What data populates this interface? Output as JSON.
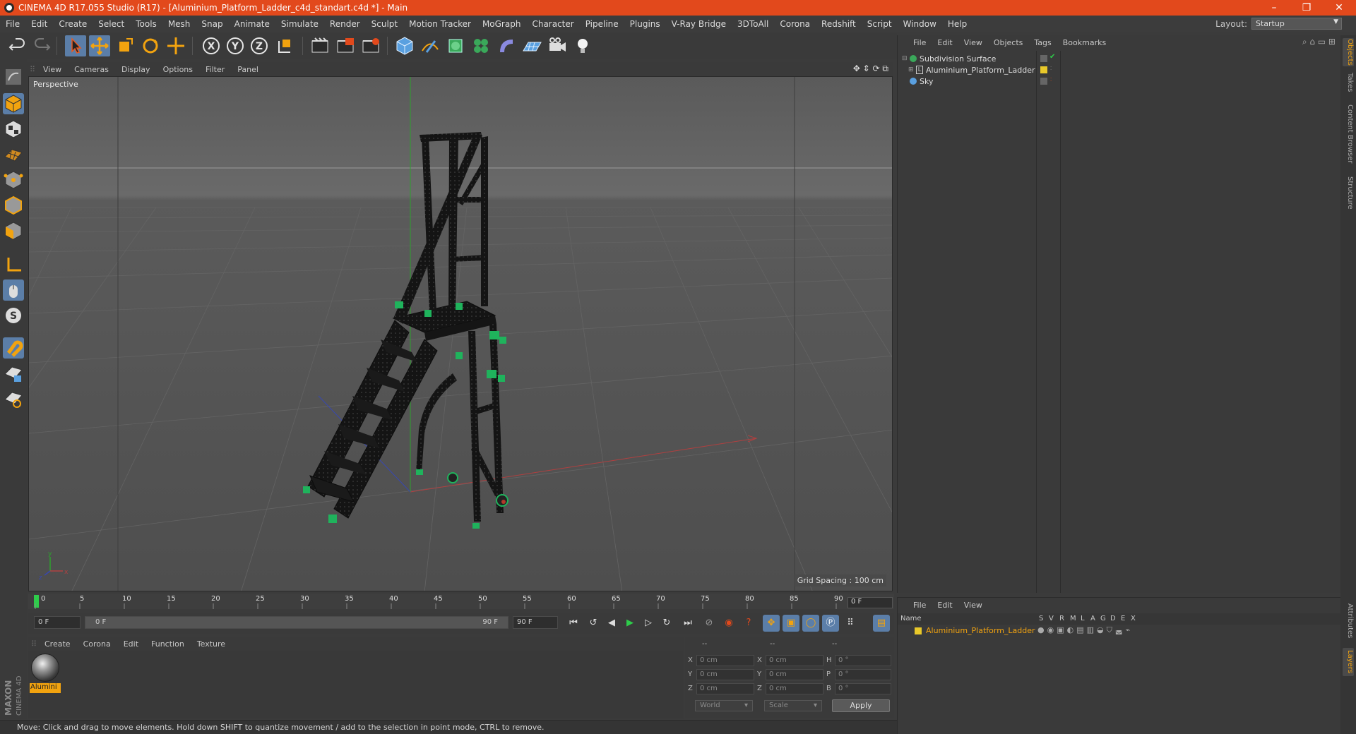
{
  "window": {
    "title": "CINEMA 4D R17.055 Studio (R17) - [Aluminium_Platform_Ladder_c4d_standart.c4d *] - Main",
    "controls": [
      "–",
      "❐",
      "✕"
    ]
  },
  "menubar": {
    "items": [
      "File",
      "Edit",
      "Create",
      "Select",
      "Tools",
      "Mesh",
      "Snap",
      "Animate",
      "Simulate",
      "Render",
      "Sculpt",
      "Motion Tracker",
      "MoGraph",
      "Character",
      "Pipeline",
      "Plugins",
      "V-Ray Bridge",
      "3DToAll",
      "Corona",
      "Redshift",
      "Script",
      "Window",
      "Help"
    ],
    "layout_label": "Layout:",
    "layout_value": "Startup"
  },
  "toolbar": {
    "axis_x": "X",
    "axis_y": "Y",
    "axis_z": "Z"
  },
  "viewport": {
    "menu": [
      "View",
      "Cameras",
      "Display",
      "Options",
      "Filter",
      "Panel"
    ],
    "camera_label": "Perspective",
    "grid_spacing": "Grid Spacing : 100 cm",
    "axis_labels": {
      "x": "x",
      "y": "y",
      "z": "z"
    }
  },
  "timeline": {
    "ticks": [
      "0",
      "5",
      "10",
      "15",
      "20",
      "25",
      "30",
      "35",
      "40",
      "45",
      "50",
      "55",
      "60",
      "65",
      "70",
      "75",
      "80",
      "85",
      "90"
    ],
    "current_frame": "0 F",
    "start_field": "0 F",
    "range_start": "0 F",
    "range_end": "90 F",
    "end_field": "90 F"
  },
  "material_manager": {
    "menu": [
      "Create",
      "Corona",
      "Edit",
      "Function",
      "Texture"
    ],
    "materials": [
      {
        "name": "Alumini"
      }
    ]
  },
  "coordinates": {
    "headers": [
      "--",
      "--",
      "--"
    ],
    "rows": [
      {
        "l1": "X",
        "v1": "0 cm",
        "l2": "X",
        "v2": "0 cm",
        "l3": "H",
        "v3": "0 °"
      },
      {
        "l1": "Y",
        "v1": "0 cm",
        "l2": "Y",
        "v2": "0 cm",
        "l3": "P",
        "v3": "0 °"
      },
      {
        "l1": "Z",
        "v1": "0 cm",
        "l2": "Z",
        "v2": "0 cm",
        "l3": "B",
        "v3": "0 °"
      }
    ],
    "space": "World",
    "mode": "Scale",
    "apply": "Apply"
  },
  "statusbar": {
    "text": "Move: Click and drag to move elements. Hold down SHIFT to quantize movement / add to the selection in point mode, CTRL to remove."
  },
  "object_manager": {
    "menu": [
      "File",
      "Edit",
      "View",
      "Objects",
      "Tags",
      "Bookmarks"
    ],
    "objects": [
      {
        "name": "Subdivision Surface"
      },
      {
        "name": "Aluminium_Platform_Ladder"
      },
      {
        "name": "Sky"
      }
    ]
  },
  "layer_manager": {
    "menu": [
      "File",
      "Edit",
      "View"
    ],
    "columns": [
      "Name",
      "S",
      "V",
      "R",
      "M",
      "L",
      "A",
      "G",
      "D",
      "E",
      "X"
    ],
    "layers": [
      {
        "name": "Aluminium_Platform_Ladder",
        "color": "#e8c82a"
      }
    ]
  },
  "side_tabs": [
    "Objects",
    "Takes",
    "Content Browser",
    "Structure",
    "Attributes",
    "Layers"
  ],
  "brand": {
    "maxon": "MAXON",
    "product": "CINEMA 4D"
  },
  "colors": {
    "accent": "#e2491c",
    "selection": "#f2a30f",
    "active_tool": "#5b7ea8"
  }
}
